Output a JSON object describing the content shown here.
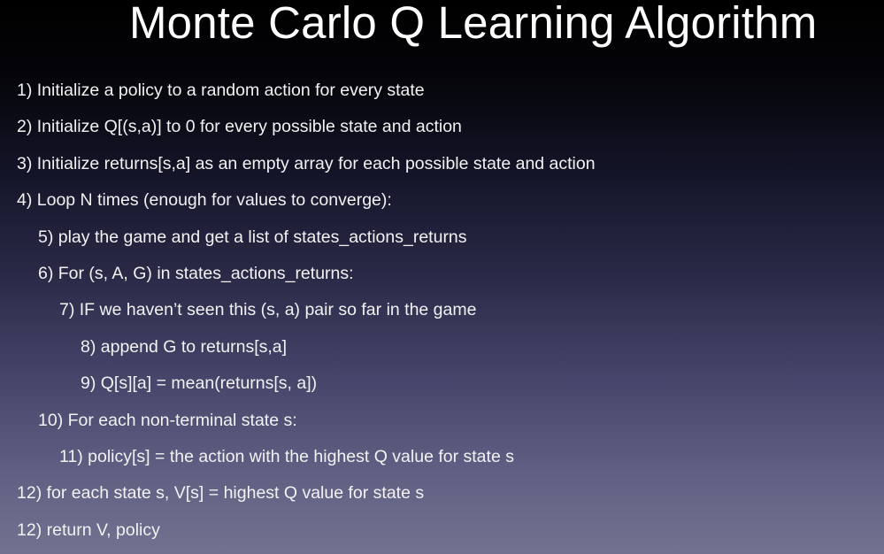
{
  "slide": {
    "title": "Monte Carlo Q Learning Algorithm",
    "steps": [
      {
        "text": "1) Initialize a policy to a random action for every state",
        "indent": 0
      },
      {
        "text": "2) Initialize Q[(s,a)] to 0 for every possible state and action",
        "indent": 0
      },
      {
        "text": "3) Initialize returns[s,a] as an empty array for each possible state and action",
        "indent": 0
      },
      {
        "text": "4) Loop N times (enough for values to converge):",
        "indent": 0
      },
      {
        "text": "5) play the game and get a list of states_actions_returns",
        "indent": 1
      },
      {
        "text": "6) For (s, A, G) in states_actions_returns:",
        "indent": 1
      },
      {
        "text": "7) IF we haven’t seen this (s, a) pair so far in the game",
        "indent": 2
      },
      {
        "text": "8) append G to returns[s,a]",
        "indent": 3
      },
      {
        "text": "9) Q[s][a] = mean(returns[s, a])",
        "indent": 3
      },
      {
        "text": "10) For each non-terminal state s:",
        "indent": 1
      },
      {
        "text": "11) policy[s] = the action with the highest Q value for state s",
        "indent": 2
      },
      {
        "text": "12) for each state s, V[s] = highest Q value for state s",
        "indent": 0
      },
      {
        "text": "12) return V, policy",
        "indent": 0
      }
    ]
  }
}
